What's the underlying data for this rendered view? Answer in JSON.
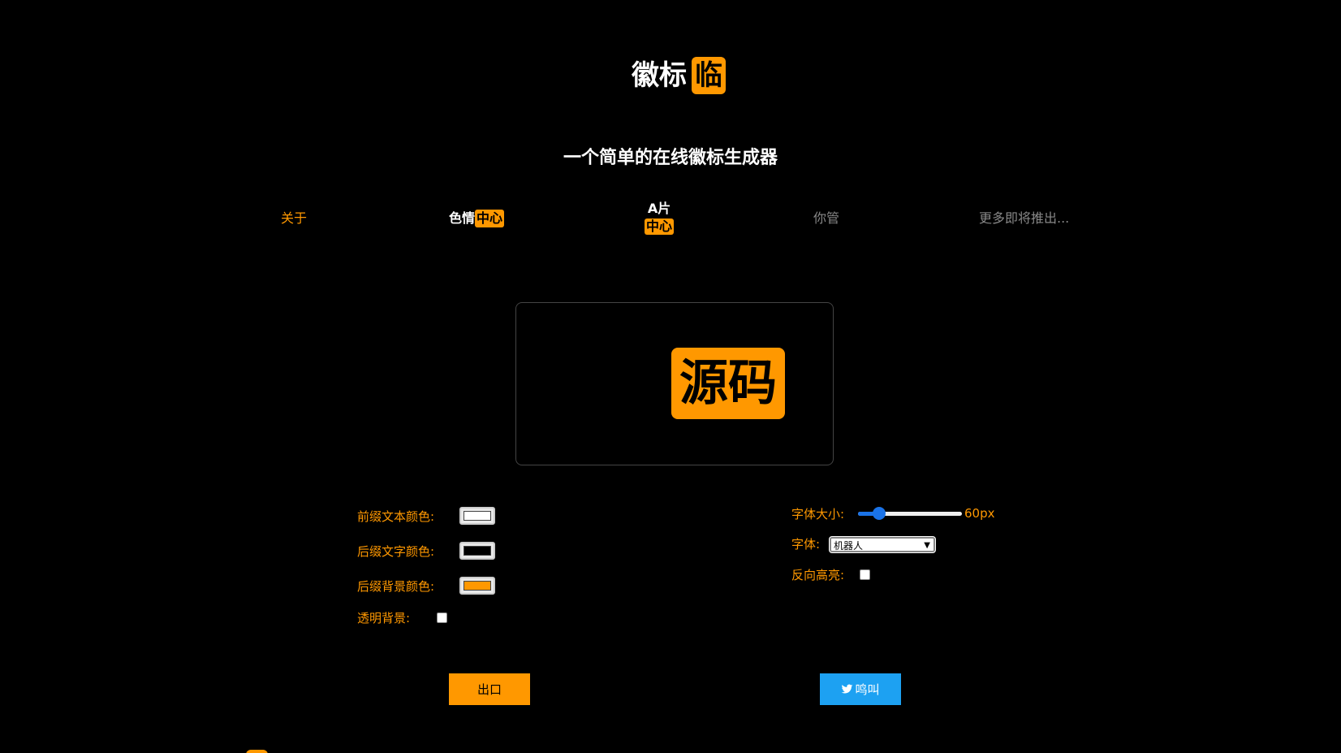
{
  "header": {
    "logo_prefix": "徽标",
    "logo_suffix": "临",
    "subtitle": "一个简单的在线徽标生成器"
  },
  "nav": {
    "about": "关于",
    "porn_prefix": "色情",
    "porn_suffix": "中心",
    "av_prefix": "A片",
    "av_suffix": "中心",
    "ni": "你管",
    "more": "更多即将推出..."
  },
  "preview": {
    "text": "源码"
  },
  "controls": {
    "prefix_color_label": "前缀文本颜色:",
    "suffix_text_color_label": "后缀文字颜色:",
    "suffix_bg_color_label": "后缀背景颜色:",
    "transparent_bg_label": "透明背景:",
    "font_size_label": "字体大小:",
    "font_size_value": "60px",
    "font_size_fraction": 0.2,
    "font_label": "字体:",
    "font_selected": "机器人",
    "reverse_highlight_label": "反向高亮:",
    "prefix_color": "#ffffff",
    "suffix_text_color": "#000000",
    "suffix_bg_color": "#ff9800"
  },
  "buttons": {
    "export": "出口",
    "tweet": "鸣叫"
  },
  "colors": {
    "accent": "#ff9800",
    "twitter": "#1da1f2",
    "slider": "#1a73e8"
  }
}
